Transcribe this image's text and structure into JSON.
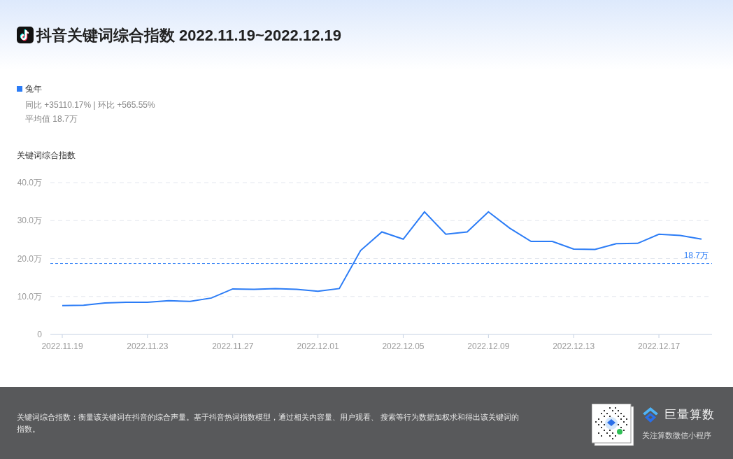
{
  "header": {
    "title": "抖音关键词综合指数 2022.11.19~2022.12.19"
  },
  "stats": [
    "同比 +35110.17% | 环比 +565.55%",
    "平均值 18.7万"
  ],
  "chart": {
    "title": "关键词综合指数",
    "chart_data": {
      "type": "line",
      "categories": [
        "2022.11.19",
        null,
        null,
        null,
        "2022.11.23",
        null,
        null,
        null,
        "2022.11.27",
        null,
        null,
        null,
        "2022.12.01",
        null,
        null,
        null,
        "2022.12.05",
        null,
        null,
        null,
        "2022.12.09",
        null,
        null,
        null,
        "2022.12.13",
        null,
        null,
        null,
        "2022.12.17",
        null,
        null
      ],
      "grid": true,
      "series": [
        {
          "name": "兔年",
          "color": "#2b7cf6",
          "values": [
            7.6,
            7.7,
            8.3,
            8.5,
            8.5,
            8.9,
            8.7,
            9.6,
            12.0,
            11.9,
            12.1,
            11.9,
            11.4,
            12.1,
            22.1,
            27.0,
            25.1,
            32.3,
            26.4,
            27.0,
            32.3,
            28.0,
            24.5,
            24.5,
            22.5,
            22.4,
            23.9,
            24.0,
            26.4,
            26.1,
            25.1
          ]
        }
      ],
      "ylim": [
        0,
        40
      ],
      "yticks": [
        {
          "value": 0,
          "label": "0"
        },
        {
          "value": 10,
          "label": "10.0万"
        },
        {
          "value": 20,
          "label": "20.0万"
        },
        {
          "value": 30,
          "label": "30.0万"
        },
        {
          "value": 40,
          "label": "40.0万"
        }
      ],
      "ref_lines": [
        {
          "axis": "y",
          "value": 18.7,
          "label": "18.7万"
        }
      ]
    }
  },
  "footer": {
    "description": "关键词综合指数：衡量该关键词在抖音的综合声量。基于抖音热词指数模型，通过相关内容量、用户观看、 搜索等行为数据加权求和得出该关键词的指数。",
    "brand": "巨量算数",
    "caption": "关注算数微信小程序"
  }
}
